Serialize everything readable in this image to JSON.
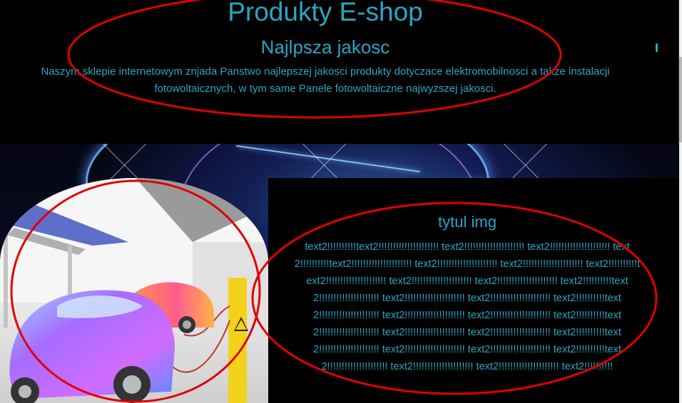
{
  "header": {
    "title": "Produkty E-shop",
    "subtitle": "Najlpsza jakosc",
    "description": "Naszym sklepie internetowym znjada Panstwo najlepszej jakosci produkty dotyczace elektromobilnosci a takze instalacji fotowoltaicznych, w tym same Panele fotowoltaiczne najwyzszej jakosci."
  },
  "card": {
    "title": "tytul img",
    "text": "text2!!!!!!!!!!text2!!!!!!!!!!!!!!!!!!!!! text2!!!!!!!!!!!!!!!!!!!!! text2!!!!!!!!!!!!!!!!!!!!! text2!!!!!!!!!!text2!!!!!!!!!!!!!!!!!!!!! text2!!!!!!!!!!!!!!!!!!!!! text2!!!!!!!!!!!!!!!!!!!!! text2!!!!!!!!!!text2!!!!!!!!!!!!!!!!!!!!! text2!!!!!!!!!!!!!!!!!!!!! text2!!!!!!!!!!!!!!!!!!!!! text2!!!!!!!!!!text2!!!!!!!!!!!!!!!!!!!!! text2!!!!!!!!!!!!!!!!!!!!! text2!!!!!!!!!!!!!!!!!!!!! text2!!!!!!!!!!text2!!!!!!!!!!!!!!!!!!!!! text2!!!!!!!!!!!!!!!!!!!!! text2!!!!!!!!!!!!!!!!!!!!! text2!!!!!!!!!!text2!!!!!!!!!!!!!!!!!!!!! text2!!!!!!!!!!!!!!!!!!!!! text2!!!!!!!!!!!!!!!!!!!!! text2!!!!!!!!!!text2!!!!!!!!!!!!!!!!!!!!! text2!!!!!!!!!!!!!!!!!!!!! text2!!!!!!!!!!!!!!!!!!!!! text2!!!!!!!!!!text2!!!!!!!!!!!!!!!!!!!!! text2!!!!!!!!!!!!!!!!!!!!! text2!!!!!!!!!!!!!!!!!!!!! text2!!!!!!!!!!"
  },
  "images": {
    "hero_background": "futuristic-car-neon-icon",
    "product_photo": "electric-car-charging-icon"
  },
  "colors": {
    "page_background": "#000000",
    "accent_text": "#2aa6c2",
    "annotation_outline": "#e00000"
  }
}
